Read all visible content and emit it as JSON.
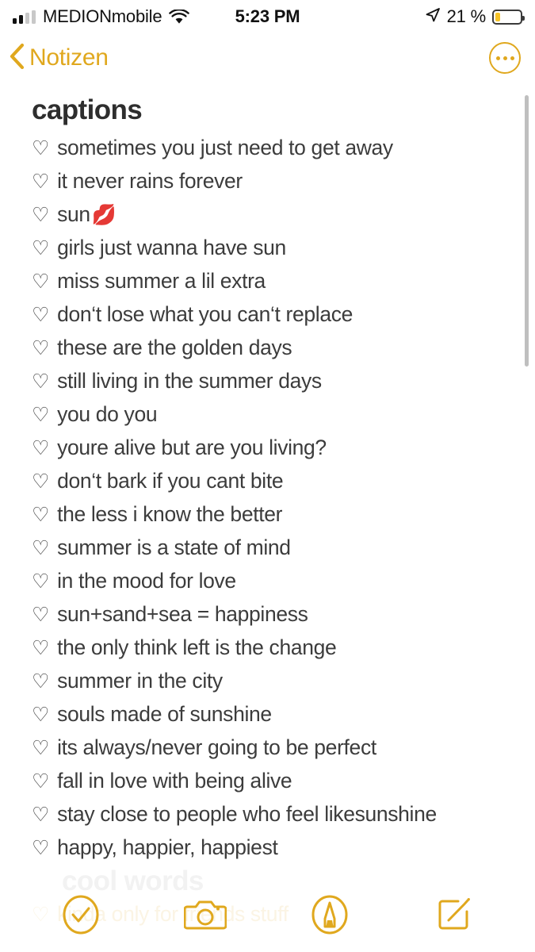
{
  "status_bar": {
    "carrier": "MEDIONmobile",
    "time": "5:23 PM",
    "battery_percent": "21 %",
    "signal_bars_filled": 2,
    "signal_bars_total": 4,
    "icons": [
      "signal-bars-icon",
      "wifi-icon",
      "location-arrow-icon",
      "battery-icon"
    ],
    "battery_color": "#F6C327",
    "text_color": "#111111"
  },
  "nav_bar": {
    "back_label": "Notizen",
    "back_icon": "chevron-left-icon",
    "more_icon": "more-circle-icon",
    "accent_color": "#E0A81E"
  },
  "note": {
    "title": "captions",
    "bullet": "♡",
    "items": [
      {
        "text": "sometimes you just need to get away",
        "emoji": ""
      },
      {
        "text": "it never rains forever",
        "emoji": ""
      },
      {
        "text": "sun",
        "emoji": "💋"
      },
      {
        "text": "girls just wanna have sun",
        "emoji": ""
      },
      {
        "text": "miss summer a lil extra",
        "emoji": ""
      },
      {
        "text": "don‘t lose what you can‘t replace",
        "emoji": ""
      },
      {
        "text": "these are the golden days",
        "emoji": ""
      },
      {
        "text": "still living in the summer days",
        "emoji": ""
      },
      {
        "text": "you do you",
        "emoji": ""
      },
      {
        "text": "youre alive but are you living?",
        "emoji": ""
      },
      {
        "text": "don‘t bark if you cant bite",
        "emoji": ""
      },
      {
        "text": "the less i know the better",
        "emoji": ""
      },
      {
        "text": "summer is a state of mind",
        "emoji": ""
      },
      {
        "text": "in the mood for love",
        "emoji": ""
      },
      {
        "text": "sun+sand+sea = happiness",
        "emoji": ""
      },
      {
        "text": "the only think left is the change",
        "emoji": ""
      },
      {
        "text": "summer in the city",
        "emoji": ""
      },
      {
        "text": "souls made of sunshine",
        "emoji": ""
      },
      {
        "text": "its always/never going to be perfect",
        "emoji": ""
      },
      {
        "text": "fall in love with being alive",
        "emoji": ""
      },
      {
        "text": "stay close to people who feel likesunshine",
        "emoji": ""
      },
      {
        "text": "happy, happier, happiest",
        "emoji": ""
      }
    ],
    "faded_next_heading": "cool words",
    "faded_next_item": "kinda only for friends stuff",
    "text_color": "#3C3C3C"
  },
  "toolbar": {
    "items": [
      {
        "name": "checklist-button",
        "icon": "check-circle-icon"
      },
      {
        "name": "camera-button",
        "icon": "camera-icon"
      },
      {
        "name": "markup-button",
        "icon": "pen-circle-icon"
      },
      {
        "name": "compose-button",
        "icon": "compose-icon"
      }
    ],
    "accent_color": "#E0A81E"
  },
  "scroll": {
    "indicator": "vertical-scroll-indicator"
  }
}
